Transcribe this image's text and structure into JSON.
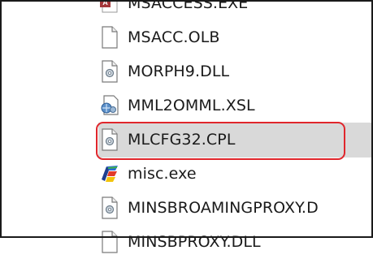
{
  "files": [
    {
      "name": "MSACCESS.EXE",
      "icon": "access-app-icon"
    },
    {
      "name": "MSACC.OLB",
      "icon": "blank-file-icon"
    },
    {
      "name": "MORPH9.DLL",
      "icon": "dll-file-icon"
    },
    {
      "name": "MML2OMML.XSL",
      "icon": "xsl-file-icon"
    },
    {
      "name": "MLCFG32.CPL",
      "icon": "cpl-file-icon",
      "selected": true
    },
    {
      "name": "misc.exe",
      "icon": "exe-app-icon"
    },
    {
      "name": "MINSBROAMINGPROXY.D",
      "icon": "dll-file-icon"
    },
    {
      "name": "MINSBPROXY.DLL",
      "icon": "dll-file-icon"
    }
  ],
  "colors": {
    "highlight": "#e0262c",
    "selection": "#d9d9d9"
  }
}
